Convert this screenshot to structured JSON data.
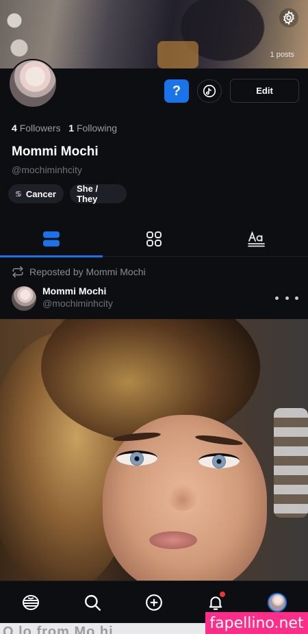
{
  "header": {
    "posts_count": "1 posts"
  },
  "profile": {
    "followers_count": "4",
    "followers_label": "Followers",
    "following_count": "1",
    "following_label": "Following",
    "display_name": "Mommi Mochi",
    "handle": "@mochiminhcity",
    "edit_label": "Edit",
    "help_label": "?",
    "chips": {
      "zodiac": "Cancer",
      "zodiac_icon": "♋",
      "pronouns": "She / They"
    }
  },
  "tabs": {
    "active": "posts",
    "items": [
      "posts",
      "grid",
      "text"
    ]
  },
  "post": {
    "repost_label": "Reposted by Mommi Mochi",
    "author_name": "Mommi Mochi",
    "author_handle": "@mochiminhcity"
  },
  "bottom_nav": {
    "items": [
      "home",
      "search",
      "create",
      "notifications",
      "profile"
    ],
    "notification_dot_color": "#e53935"
  },
  "peek_text": "Q lo from  Mo hi",
  "watermark": "fapellino.net",
  "colors": {
    "accent": "#1a73e8",
    "background": "#0d0e12",
    "watermark": "#ff2d8a"
  }
}
